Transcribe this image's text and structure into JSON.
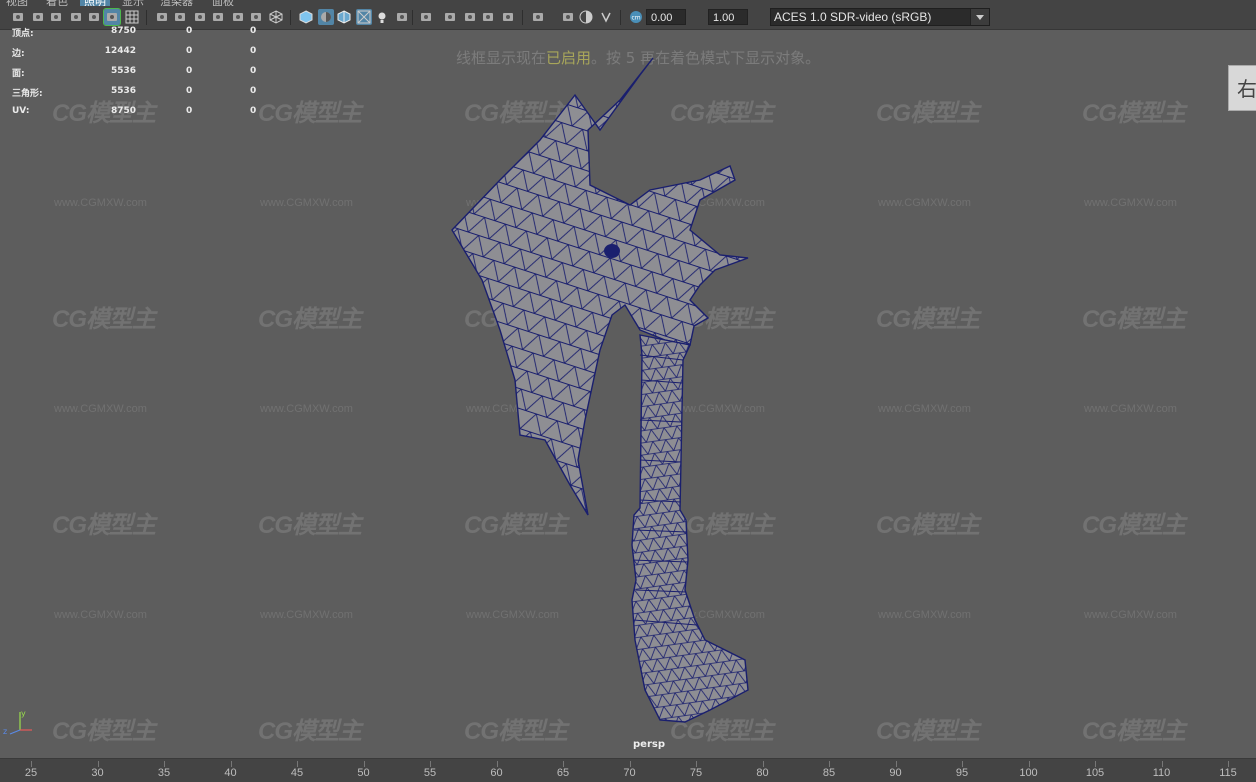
{
  "menubar": {
    "items": [
      "视图",
      "着色",
      "照明",
      "显示",
      "渲染器",
      "面板"
    ],
    "active_index": 2
  },
  "toolbar": {
    "icons": [
      "camera-select-icon",
      "camera-attributes-icon",
      "bookmark-icon",
      "image-plane-icon",
      "2d-pan-zoom-icon",
      "grease-pencil-icon",
      "grid-icon",
      "film-gate-icon",
      "resolution-gate-icon",
      "gate-mask-icon",
      "field-chart-icon",
      "safe-action-icon",
      "safe-title-icon",
      "wireframe-icon",
      "smooth-shade-icon",
      "default-material-icon",
      "wireframe-on-shaded-icon",
      "xray-icon",
      "use-default-light-icon",
      "shadows-icon",
      "screen-space-ao-icon",
      "motion-blur-icon",
      "multisample-aa-icon",
      "depth-of-field-icon",
      "isolate-select-icon",
      "xray-joints-icon",
      "xray-active-icon",
      "exposure-icon",
      "gamma-icon",
      "color-management-icon"
    ],
    "exposure_value": "0.00",
    "gamma_value": "1.00",
    "color_space": "ACES 1.0 SDR-video (sRGB)"
  },
  "hud": {
    "rows": [
      {
        "label": "顶点:",
        "v1": "8750",
        "v2": "0",
        "v3": "0"
      },
      {
        "label": "边:",
        "v1": "12442",
        "v2": "0",
        "v3": "0"
      },
      {
        "label": "面:",
        "v1": "5536",
        "v2": "0",
        "v3": "0"
      },
      {
        "label": "三角形:",
        "v1": "5536",
        "v2": "0",
        "v3": "0"
      },
      {
        "label": "UV:",
        "v1": "8750",
        "v2": "0",
        "v3": "0"
      }
    ]
  },
  "viewport": {
    "wire_message_pre": "线框显示现在",
    "wire_message_hl": "已启用",
    "wire_message_post": "。按 5 再在着色模式下显示对象。",
    "camera": "persp",
    "view_cube_label": "右",
    "mesh_color": "#1a1f6e",
    "mesh_fill": "#8e8e93"
  },
  "watermark": {
    "logo": "CG模型主",
    "url": "www.CGMXW.com"
  },
  "timeline": {
    "labels": [
      "25",
      "30",
      "35",
      "40",
      "45",
      "50",
      "55",
      "60",
      "65",
      "70",
      "75",
      "80",
      "85",
      "90",
      "95",
      "100",
      "105",
      "110",
      "115"
    ]
  }
}
